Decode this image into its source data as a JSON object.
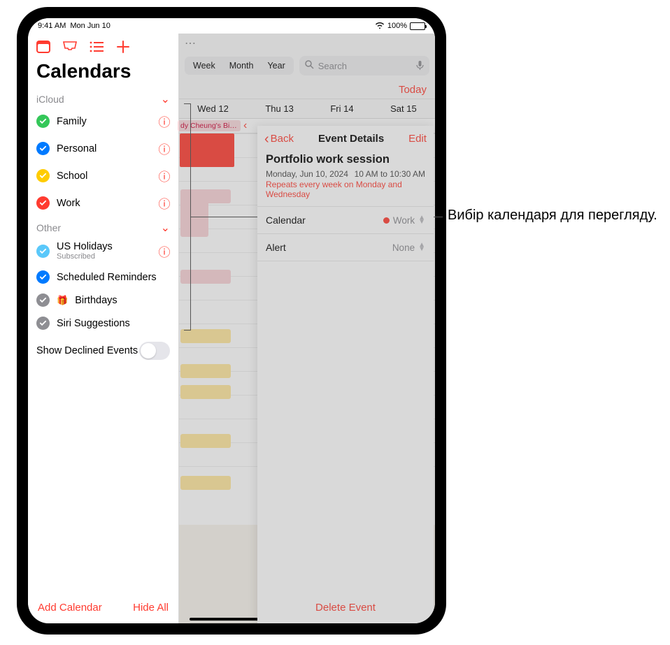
{
  "status": {
    "time": "9:41 AM",
    "date": "Mon Jun 10",
    "battery": "100%"
  },
  "sidebar": {
    "title": "Calendars",
    "sections": [
      {
        "name": "iCloud",
        "items": [
          {
            "label": "Family",
            "color": "#34c759",
            "info": true
          },
          {
            "label": "Personal",
            "color": "#007aff",
            "info": true
          },
          {
            "label": "School",
            "color": "#ffcc00",
            "info": true
          },
          {
            "label": "Work",
            "color": "#ff3b30",
            "info": true
          }
        ]
      },
      {
        "name": "Other",
        "items": [
          {
            "label": "US Holidays",
            "sub": "Subscribed",
            "color": "#5ac8fa",
            "info": true
          },
          {
            "label": "Scheduled Reminders",
            "color": "#007aff",
            "info": false
          },
          {
            "label": "Birthdays",
            "color": "#8e8e93",
            "info": false,
            "gift": true
          },
          {
            "label": "Siri Suggestions",
            "color": "#8e8e93",
            "info": false
          }
        ]
      }
    ],
    "toggle_label": "Show Declined Events",
    "footer": {
      "add": "Add Calendar",
      "hide": "Hide All"
    }
  },
  "main": {
    "views": [
      "Week",
      "Month",
      "Year"
    ],
    "search_placeholder": "Search",
    "today": "Today",
    "days": [
      "Wed 12",
      "Thu 13",
      "Fri 14",
      "Sat 15"
    ],
    "chip": "dy Cheung's Bi…"
  },
  "popover": {
    "back": "Back",
    "title": "Event Details",
    "edit": "Edit",
    "event_name": "Portfolio work session",
    "date": "Monday, Jun 10, 2024",
    "time": "10 AM to 10:30 AM",
    "repeat": "Repeats every week on Monday and Wednesday",
    "cal_label": "Calendar",
    "cal_value": "Work",
    "alert_label": "Alert",
    "alert_value": "None",
    "delete": "Delete Event"
  },
  "callout": "Вибір календаря для перегляду."
}
